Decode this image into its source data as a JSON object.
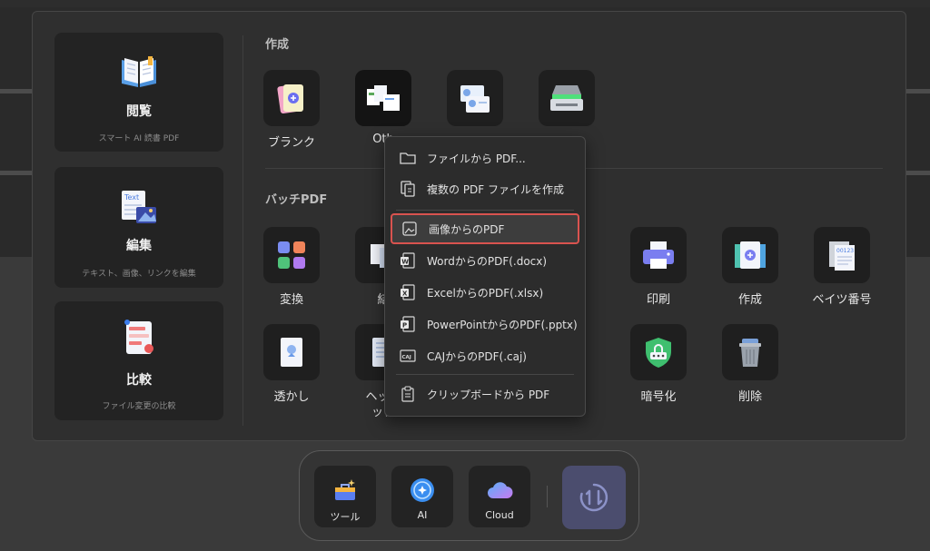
{
  "sidebar": [
    {
      "title": "閲覧",
      "sub": "スマート AI 読書 PDF"
    },
    {
      "title": "編集",
      "sub": "テキスト、画像、リンクを編集"
    },
    {
      "title": "比較",
      "sub": "ファイル変更の比較"
    }
  ],
  "sections": {
    "create": "作成",
    "batch": "バッチPDF"
  },
  "create_tools": [
    {
      "label": "ブランク",
      "icon": "blank-document-icon"
    },
    {
      "label": "Oth",
      "icon": "other-documents-icon"
    },
    {
      "label": "",
      "icon": "id-card-icon"
    },
    {
      "label": "ー",
      "icon": "scanner-icon"
    }
  ],
  "batch_tools_row1": [
    {
      "label": "変換",
      "icon": "convert-grid-icon"
    },
    {
      "label": "結",
      "icon": "combine-icon"
    },
    {
      "label": "印刷",
      "icon": "printer-icon"
    },
    {
      "label": "作成",
      "icon": "create-pdf-icon"
    },
    {
      "label": "ベイツ番号",
      "icon": "bates-number-icon"
    }
  ],
  "batch_tools_row2": [
    {
      "label": "透かし",
      "icon": "watermark-icon"
    },
    {
      "label": "ヘッダ",
      "label2": "ック",
      "icon": "header-footer-icon"
    },
    {
      "label": "暗号化",
      "icon": "shield-lock-icon"
    },
    {
      "label": "削除",
      "icon": "trash-icon"
    }
  ],
  "context_menu": [
    {
      "label": "ファイルから PDF...",
      "icon": "folder-icon"
    },
    {
      "label": "複数の PDF ファイルを作成",
      "icon": "multi-file-icon"
    },
    {
      "label": "画像からのPDF",
      "icon": "image-icon",
      "selected": true
    },
    {
      "label": "WordからのPDF(.docx)",
      "icon": "word-icon"
    },
    {
      "label": "ExcelからのPDF(.xlsx)",
      "icon": "excel-icon"
    },
    {
      "label": "PowerPointからのPDF(.pptx)",
      "icon": "powerpoint-icon"
    },
    {
      "label": "CAJからのPDF(.caj)",
      "icon": "caj-icon"
    },
    {
      "label": "クリップボードから PDF",
      "icon": "clipboard-icon"
    }
  ],
  "dock": {
    "tools": "ツール",
    "ai": "AI",
    "cloud": "Cloud"
  },
  "colors": {
    "selection_border": "#d9534f",
    "accent": "#5b6bd6"
  }
}
